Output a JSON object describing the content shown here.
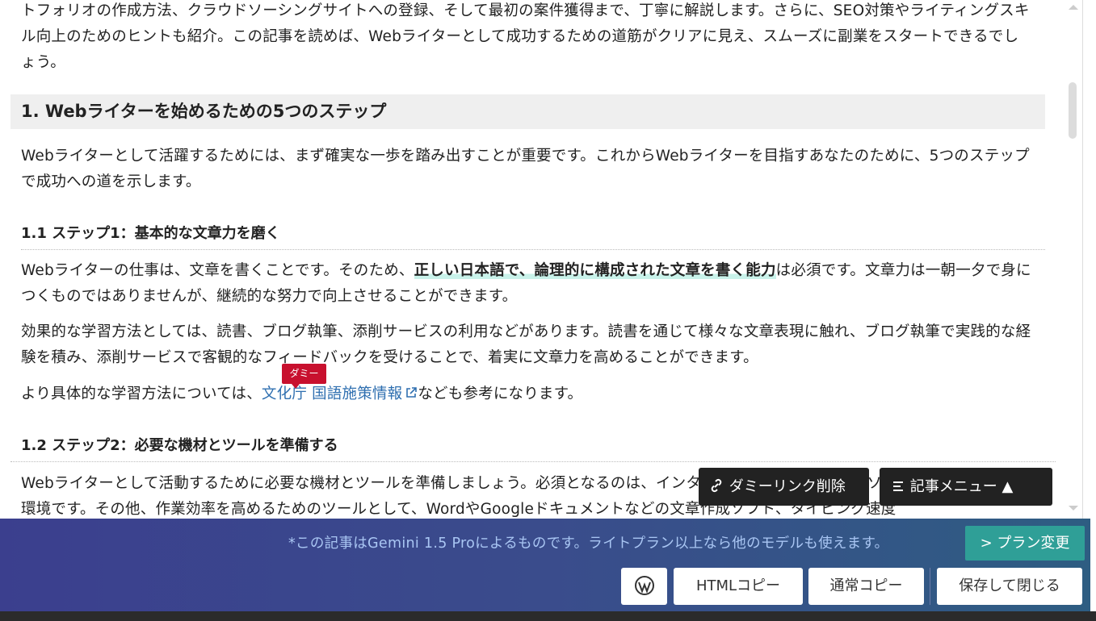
{
  "article": {
    "intro": "トフォリオの作成方法、クラウドソーシングサイトへの登録、そして最初の案件獲得まで、丁寧に解説します。さらに、SEO対策やライティングスキル向上のためのヒントも紹介。この記事を読めば、Webライターとして成功するための道筋がクリアに見え、スムーズに副業をスタートできるでしょう。",
    "h2": "1. Webライターを始めるための5つのステップ",
    "p1": "Webライターとして活躍するためには、まず確実な一歩を踏み出すことが重要です。これからWebライターを目指すあなたのために、5つのステップで成功への道を示します。",
    "h3_1": "1.1 ステップ1：基本的な文章力を磨く",
    "p2_before": "Webライターの仕事は、文章を書くことです。そのため、",
    "p2_highlight": "正しい日本語で、論理的に構成された文章を書く能力",
    "p2_after": "は必須です。文章力は一朝一夕で身につくものではありませんが、継続的な努力で向上させることができます。",
    "p3": "効果的な学習方法としては、読書、ブログ執筆、添削サービスの利用などがあります。読書を通じて様々な文章表現に触れ、ブログ執筆で実践的な経験を積み、添削サービスで客観的なフィードバックを受けることで、着実に文章力を高めることができます。",
    "p4_before": "より具体的な学習方法については、",
    "p4_link": "文化庁 国語施策情報",
    "p4_after": "なども参考になります。",
    "dummy_tag": "ダミー",
    "h3_2": "1.2 ステップ2：必要な機材とツールを準備する",
    "p5": "Webライターとして活動するために必要な機材とツールを準備しましょう。必須となるのは、インターネットに接続できるパソコンと、安定した通信環境です。その他、作業効率を高めるためのツールとして、WordやGoogleドキュメントなどの文章作成ソフト、タイピング速度"
  },
  "float_buttons": {
    "remove_dummy": "ダミーリンク削除",
    "article_menu": "記事メニュー ▲"
  },
  "footer": {
    "notice": "*この記事はGemini 1.5 Proによるものです。ライトプラン以上なら他のモデルも使えます。",
    "plan_change": "> プラン変更",
    "html_copy": "HTMLコピー",
    "normal_copy": "通常コピー",
    "save_close": "保存して閉じる"
  },
  "icons": {
    "link": "link-icon",
    "menu": "menu-icon",
    "wordpress": "wordpress-icon",
    "external": "external-link-icon"
  },
  "colors": {
    "link": "#2f6fb0",
    "dummy_tag": "#c8102e",
    "plan_button": "#2f9f97",
    "footer_notice": "#a9c6f3"
  }
}
